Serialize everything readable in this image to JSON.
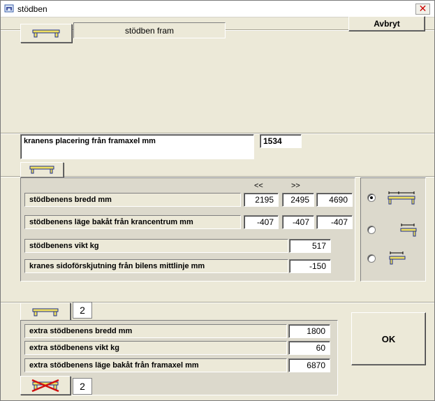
{
  "window": {
    "title": "stödben",
    "close_symbol": "✕"
  },
  "header": {
    "front_label": "stödben fram",
    "cancel_label": "Avbryt"
  },
  "crane_placement": {
    "label": "kranens placering från framaxel  mm",
    "value": "1534"
  },
  "table": {
    "arrow_left": "<<",
    "arrow_right": ">>",
    "rows": [
      {
        "label": "stödbenens bredd   mm",
        "values": [
          "2195",
          "2495",
          "4690"
        ]
      },
      {
        "label": "stödbenens läge bakåt från krancentrum  mm",
        "values": [
          "-407",
          "-407",
          "-407"
        ]
      }
    ],
    "weight": {
      "label": "stödbenens vikt   kg",
      "value": "517"
    },
    "side_offset": {
      "label": "kranes sidoförskjutning från bilens mittlinje   mm",
      "value": "-150"
    }
  },
  "options": {
    "selected_index": 0
  },
  "extra": {
    "count_top": "2",
    "rows": [
      {
        "label": "extra stödbenens bredd   mm",
        "value": "1800"
      },
      {
        "label": "extra stödbenens vikt   kg",
        "value": "60"
      },
      {
        "label": "extra stödbenens läge bakåt från framaxel  mm",
        "value": "6870"
      }
    ],
    "count_bottom": "2"
  },
  "ok_label": "OK",
  "colors": {
    "leg_yellow": "#f0e060",
    "beam_blue": "#1e2f8a",
    "remove_red": "#d01010"
  }
}
